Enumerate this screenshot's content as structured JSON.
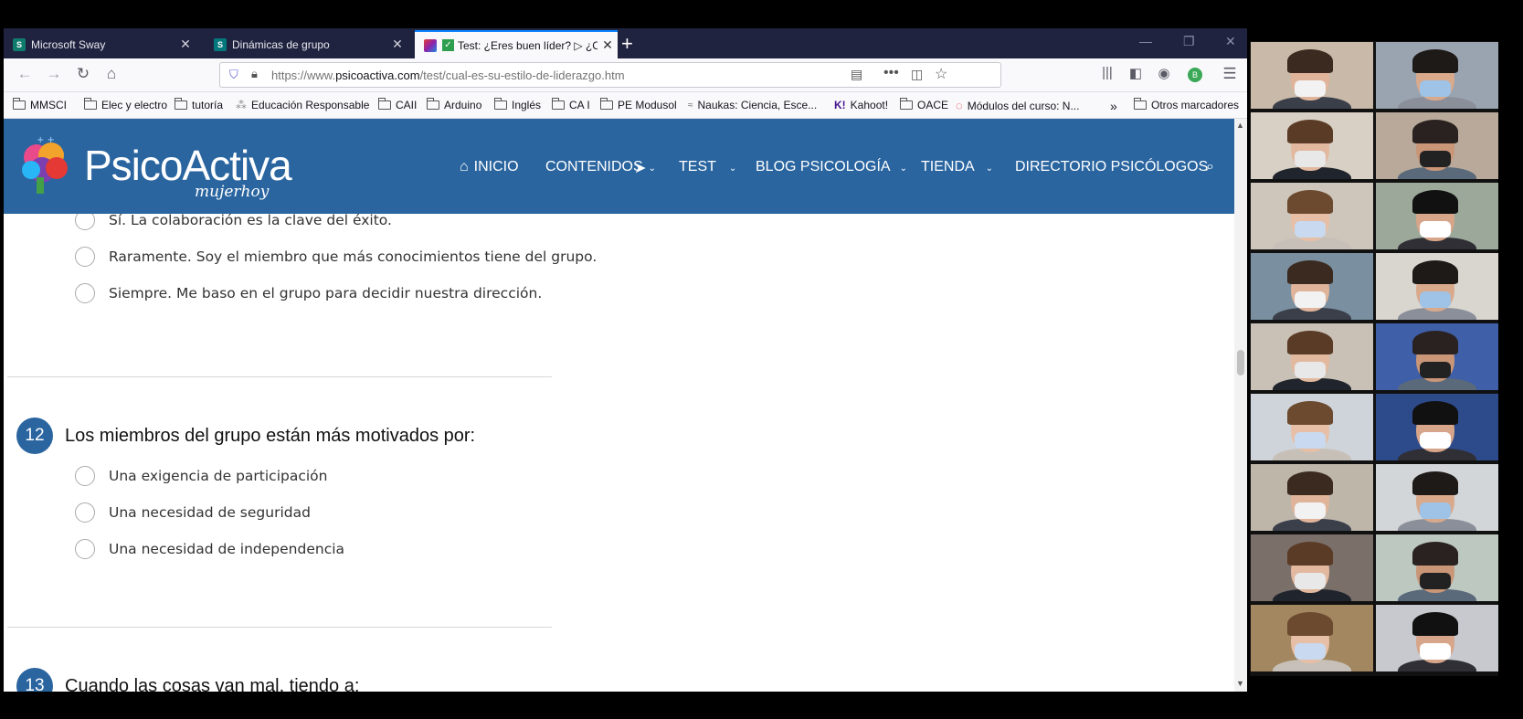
{
  "browser": {
    "tabs": [
      {
        "title": "Microsoft Sway",
        "icon": "sway-icon",
        "badge": "S"
      },
      {
        "title": "Dinámicas de grupo",
        "icon": "sharepoint-icon",
        "badge": "S"
      },
      {
        "title": "Test: ¿Eres buen líder? ▷ ¿Cu",
        "icon": "psicoactiva-favicon-icon",
        "active": true
      }
    ],
    "url_prefix": "https://www.",
    "url_domain": "psicoactiva.com",
    "url_path": "/test/cual-es-su-estilo-de-liderazgo.htm",
    "bookmarks": [
      "MMSCI",
      "Elec y electro",
      "tutoría",
      "Educación Responsable",
      "CAII",
      "Arduino",
      "Inglés",
      "CA I",
      "PE Modusol",
      "Naukas: Ciencia, Esce...",
      "Kahoot!",
      "OACE",
      "Módulos del curso: N...",
      "Otros marcadores"
    ]
  },
  "site": {
    "logo_main": "PsicoActiva",
    "logo_sub": "mujerhoy",
    "menu": [
      "INICIO",
      "CONTENIDOS",
      "TEST",
      "BLOG PSICOLOGÍA",
      "TIENDA",
      "DIRECTORIO PSICÓLOGOS"
    ]
  },
  "quiz": {
    "prev_options": [
      "Sí. La colaboración es la clave del éxito.",
      "Raramente. Soy el miembro que más conocimientos tiene del grupo.",
      "Siempre. Me baso en el grupo para decidir nuestra dirección."
    ],
    "q12": {
      "number": "12",
      "text": "Los miembros del grupo están más motivados por:",
      "options": [
        "Una exigencia de participación",
        "Una necesidad de seguridad",
        "Una necesidad de independencia"
      ]
    },
    "q13": {
      "number": "13",
      "text": "Cuando las cosas van mal, tiendo a:"
    }
  },
  "colors": {
    "header": "#2a65a0",
    "tabbar": "#202340",
    "accent": "#0a84ff"
  },
  "participants_count": 18
}
